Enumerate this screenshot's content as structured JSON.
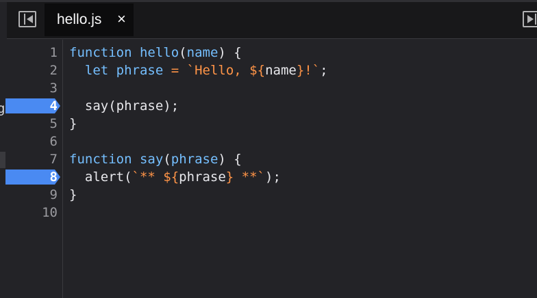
{
  "tab": {
    "label": "hello.js",
    "close_glyph": "×"
  },
  "left_panel_clipped_char": "g",
  "breakpoints": [
    "4",
    "8"
  ],
  "colors": {
    "keyword": "#75bfff",
    "string": "#ff9447",
    "breakpoint": "#4a8af2",
    "background": "#232327"
  },
  "lines": [
    {
      "num": "1",
      "tokens": [
        [
          "kw",
          "function"
        ],
        [
          "punc",
          " "
        ],
        [
          "fn",
          "hello"
        ],
        [
          "punc",
          "("
        ],
        [
          "fn",
          "name"
        ],
        [
          "punc",
          ") {"
        ]
      ]
    },
    {
      "num": "2",
      "tokens": [
        [
          "punc",
          "  "
        ],
        [
          "kw",
          "let"
        ],
        [
          "punc",
          " "
        ],
        [
          "fn",
          "phrase"
        ],
        [
          "punc",
          " "
        ],
        [
          "str",
          "="
        ],
        [
          "punc",
          " "
        ],
        [
          "str",
          "`Hello, ${"
        ],
        [
          "punc",
          "name"
        ],
        [
          "str",
          "}!`"
        ],
        [
          "punc",
          ";"
        ]
      ]
    },
    {
      "num": "3",
      "tokens": []
    },
    {
      "num": "4",
      "tokens": [
        [
          "punc",
          "  say(phrase);"
        ]
      ]
    },
    {
      "num": "5",
      "tokens": [
        [
          "punc",
          "}"
        ]
      ]
    },
    {
      "num": "6",
      "tokens": []
    },
    {
      "num": "7",
      "tokens": [
        [
          "kw",
          "function"
        ],
        [
          "punc",
          " "
        ],
        [
          "fn",
          "say"
        ],
        [
          "punc",
          "("
        ],
        [
          "fn",
          "phrase"
        ],
        [
          "punc",
          ") {"
        ]
      ]
    },
    {
      "num": "8",
      "tokens": [
        [
          "punc",
          "  alert("
        ],
        [
          "str",
          "`** ${"
        ],
        [
          "punc",
          "phrase"
        ],
        [
          "str",
          "} **`"
        ],
        [
          "punc",
          ");"
        ]
      ]
    },
    {
      "num": "9",
      "tokens": [
        [
          "punc",
          "}"
        ]
      ]
    },
    {
      "num": "10",
      "tokens": []
    }
  ]
}
